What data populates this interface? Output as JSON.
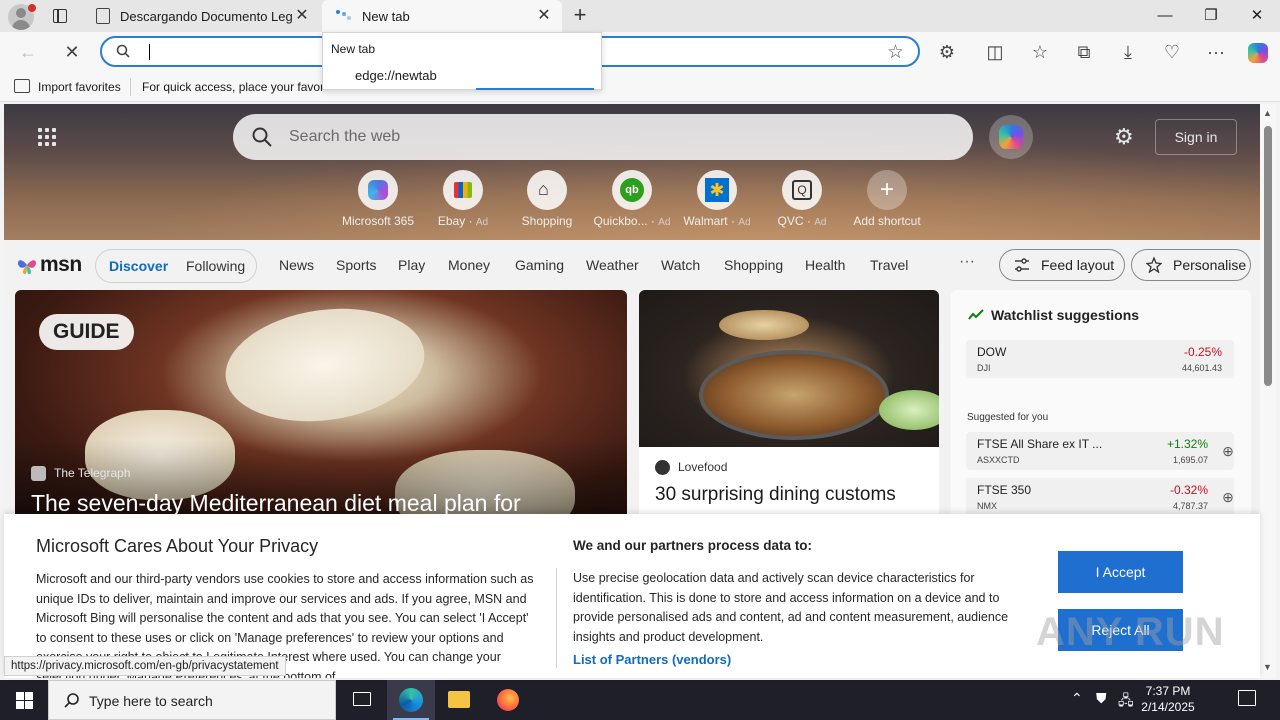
{
  "browser": {
    "tabs": [
      {
        "title": "Descargando Documento Legal",
        "active": false
      },
      {
        "title": "New tab",
        "active": true
      }
    ],
    "address_value": "",
    "omnibox": {
      "header": "New tab",
      "suggestion": "edge://newtab"
    },
    "favorites_bar": {
      "import_label": "Import favorites",
      "hint": "For quick access, place your favorites here on the favorites bar."
    }
  },
  "newtab": {
    "search_placeholder": "Search the web",
    "sign_in": "Sign in",
    "shortcuts": [
      {
        "label": "Microsoft 365",
        "ad": ""
      },
      {
        "label": "Ebay",
        "ad": "Ad"
      },
      {
        "label": "Shopping",
        "ad": ""
      },
      {
        "label": "Quickbo...",
        "ad": "Ad"
      },
      {
        "label": "Walmart",
        "ad": "Ad"
      },
      {
        "label": "QVC",
        "ad": "Ad"
      },
      {
        "label": "Add shortcut",
        "ad": ""
      }
    ]
  },
  "msn": {
    "logo": "msn",
    "tabs": {
      "discover": "Discover",
      "following": "Following"
    },
    "nav": [
      "News",
      "Sports",
      "Play",
      "Money",
      "Gaming",
      "Weather",
      "Watch",
      "Shopping",
      "Health",
      "Travel"
    ],
    "more": "···",
    "feed_layout": "Feed layout",
    "personalise": "Personalise"
  },
  "cards": {
    "big": {
      "badge": "GUIDE",
      "source": "The Telegraph",
      "title": "The seven-day Mediterranean diet meal plan for"
    },
    "mid": {
      "source": "Lovefood",
      "title": "30 surprising dining customs"
    }
  },
  "watchlist": {
    "title": "Watchlist suggestions",
    "menu": "···",
    "items": [
      {
        "name": "DOW",
        "symbol": "DJI",
        "change": "-0.25%",
        "price": "44,601.43",
        "direction": "down"
      }
    ],
    "suggested_label": "Suggested for you",
    "suggested": [
      {
        "name": "FTSE All Share ex IT ...",
        "symbol": "ASXXCTD",
        "change": "+1.32%",
        "price": "1,695.07",
        "direction": "up"
      },
      {
        "name": "FTSE 350",
        "symbol": "NMX",
        "change": "-0.32%",
        "price": "4,787.37",
        "direction": "down"
      }
    ]
  },
  "privacy": {
    "title": "Microsoft Cares About Your Privacy",
    "body": "Microsoft and our third-party vendors use cookies to store and access information such as unique IDs to deliver, maintain and improve our services and ads. If you agree, MSN and Microsoft Bing will personalise the content and ads that you see. You can select 'I Accept' to consent to these uses or click on 'Manage preferences' to review your options and exercise your right to object to Legitimate Interest where used. You can change your selection under 'Manage Preferences' at the bottom of",
    "process_title": "We and our partners process data to:",
    "process_body": "Use precise geolocation data and actively scan device characteristics for identification. This is done to store and access information on a device and to provide personalised ads and content, ad and content measurement, audience insights and product development.",
    "partners_link": "List of Partners (vendors)",
    "accept": "I Accept",
    "reject": "Reject All"
  },
  "status_url": "https://privacy.microsoft.com/en-gb/privacystatement",
  "watermark": "ANY RUN",
  "taskbar": {
    "search_placeholder": "Type here to search",
    "time": "7:37 PM",
    "date": "2/14/2025"
  }
}
